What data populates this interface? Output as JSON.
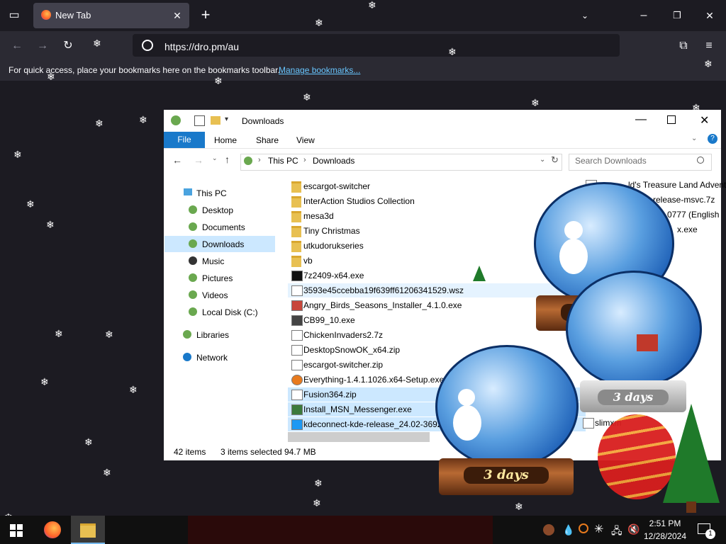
{
  "browser": {
    "tab_title": "New Tab",
    "url": "https://dro.pm/au",
    "bookmarks_message": "For quick access, place your bookmarks here on the bookmarks toolbar.",
    "bookmarks_link": "Manage bookmarks..."
  },
  "explorer": {
    "title": "Downloads",
    "ribbon_tabs": [
      "File",
      "Home",
      "Share",
      "View"
    ],
    "breadcrumb": [
      "This PC",
      "Downloads"
    ],
    "search_placeholder": "Search Downloads",
    "nav_items": [
      "This PC",
      "Desktop",
      "Documents",
      "Downloads",
      "Music",
      "Pictures",
      "Videos",
      "Local Disk (C:)",
      "Libraries",
      "Network"
    ],
    "files": [
      {
        "name": "escargot-switcher",
        "type": "folder",
        "selected": false
      },
      {
        "name": "InterAction Studios Collection",
        "type": "folder",
        "selected": false
      },
      {
        "name": "mesa3d",
        "type": "folder",
        "selected": false
      },
      {
        "name": "Tiny Christmas",
        "type": "folder",
        "selected": false
      },
      {
        "name": "utkudorukseries",
        "type": "folder",
        "selected": false
      },
      {
        "name": "vb",
        "type": "folder",
        "selected": false
      },
      {
        "name": "7z2409-x64.exe",
        "type": "file",
        "selected": false
      },
      {
        "name": "3593e45ccebba19f639ff61206341529.wsz",
        "type": "file",
        "selected": false
      },
      {
        "name": "Angry_Birds_Seasons_Installer_4.1.0.exe",
        "type": "file",
        "selected": false
      },
      {
        "name": "CB99_10.exe",
        "type": "file",
        "selected": false
      },
      {
        "name": "ChickenInvaders2.7z",
        "type": "file",
        "selected": false
      },
      {
        "name": "DesktopSnowOK_x64.zip",
        "type": "file",
        "selected": false
      },
      {
        "name": "escargot-switcher.zip",
        "type": "file",
        "selected": false
      },
      {
        "name": "Everything-1.4.1.1026.x64-Setup.exe",
        "type": "file",
        "selected": false
      },
      {
        "name": "Fusion364.zip",
        "type": "file",
        "selected": true
      },
      {
        "name": "Install_MSN_Messenger.exe",
        "type": "file",
        "selected": true
      },
      {
        "name": "kdeconnect-kde-release_24.02-3692",
        "type": "file",
        "selected": true
      }
    ],
    "right_column": [
      {
        "name": "ld's Treasure Land Advent"
      },
      {
        "name": "release-msvc.7z"
      },
      {
        "name": "0.0777 (English"
      },
      {
        "name": "x.exe"
      },
      {
        "name": "slimxm"
      }
    ],
    "item_count": "42 items",
    "selected_info": "3 items selected",
    "selected_size": "94.7 MB"
  },
  "globes": {
    "label": "3 days"
  },
  "taskbar": {
    "time": "2:51 PM",
    "date": "12/28/2024",
    "notification_count": "1"
  }
}
